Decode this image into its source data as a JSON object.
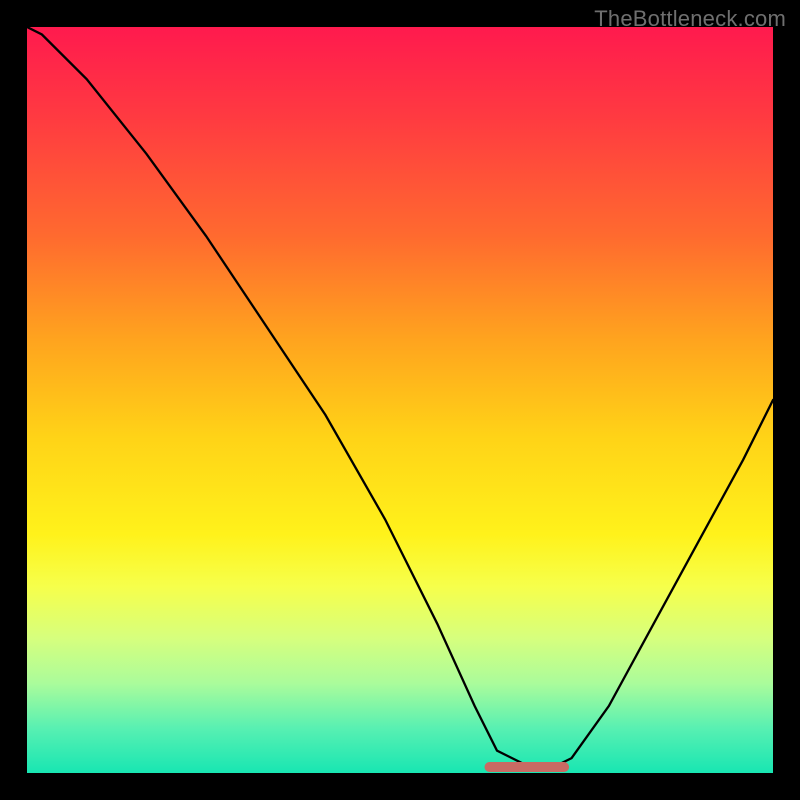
{
  "attribution": "TheBottleneck.com",
  "chart_data": {
    "type": "line",
    "title": "",
    "xlabel": "",
    "ylabel": "",
    "xlim": [
      0,
      1
    ],
    "ylim": [
      0,
      1
    ],
    "series": [
      {
        "name": "bottleneck-curve",
        "x": [
          0.0,
          0.02,
          0.08,
          0.16,
          0.24,
          0.32,
          0.4,
          0.48,
          0.55,
          0.6,
          0.63,
          0.67,
          0.71,
          0.73,
          0.78,
          0.84,
          0.9,
          0.96,
          1.0
        ],
        "y": [
          1.0,
          0.99,
          0.93,
          0.83,
          0.72,
          0.6,
          0.48,
          0.34,
          0.2,
          0.09,
          0.03,
          0.01,
          0.01,
          0.02,
          0.09,
          0.2,
          0.31,
          0.42,
          0.5
        ]
      }
    ],
    "flat_region": {
      "x_start": 0.62,
      "x_end": 0.72,
      "y": 0.008
    },
    "background_gradient": {
      "direction": "vertical",
      "stops": [
        {
          "pos": 0.0,
          "color": "#ff1a4e"
        },
        {
          "pos": 0.28,
          "color": "#ff6a2f"
        },
        {
          "pos": 0.55,
          "color": "#ffd317"
        },
        {
          "pos": 0.75,
          "color": "#f6ff4b"
        },
        {
          "pos": 0.94,
          "color": "#58f0b2"
        },
        {
          "pos": 1.0,
          "color": "#18e6b2"
        }
      ]
    }
  }
}
